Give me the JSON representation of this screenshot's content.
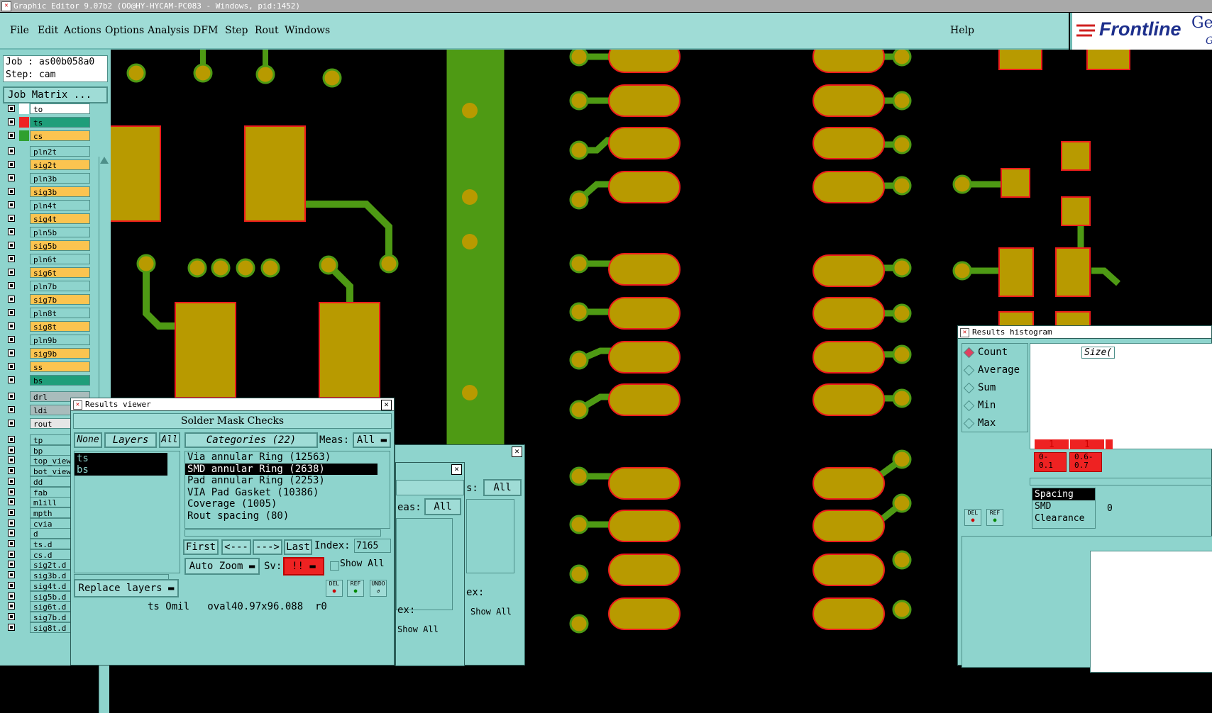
{
  "window": {
    "title": "Graphic Editor 9.07b2 (OO@HY-HYCAM-PC083 - Windows, pid:1452)"
  },
  "menu": {
    "file": "File",
    "edit": "Edit",
    "actions": "Actions",
    "options": "Options",
    "analysis": "Analysis",
    "dfm": "DFM",
    "step": "Step",
    "rout": "Rout",
    "windows": "Windows",
    "help": "Help"
  },
  "logo": {
    "brand": "Frontline",
    "brand_suffix": "Ge",
    "brand_sub": "G"
  },
  "job": {
    "job_label": "Job : as00b058a0",
    "step_label": "Step: cam",
    "matrix_button": "Job Matrix ..."
  },
  "layers": [
    {
      "name": "to",
      "color": "#ffffff",
      "bg": "#ffffff"
    },
    {
      "name": "ts",
      "color": "#ee2222",
      "bg": "#1f9e7a",
      "active": true
    },
    {
      "name": "cs",
      "color": "#2fa02f",
      "bg": "#fbc450"
    },
    {
      "name": "pln2t",
      "color": "",
      "bg": "#8ed4cd"
    },
    {
      "name": "sig2t",
      "color": "",
      "bg": "#fbc450"
    },
    {
      "name": "pln3b",
      "color": "",
      "bg": "#8ed4cd"
    },
    {
      "name": "sig3b",
      "color": "",
      "bg": "#fbc450"
    },
    {
      "name": "pln4t",
      "color": "",
      "bg": "#8ed4cd"
    },
    {
      "name": "sig4t",
      "color": "",
      "bg": "#fbc450"
    },
    {
      "name": "pln5b",
      "color": "",
      "bg": "#8ed4cd"
    },
    {
      "name": "sig5b",
      "color": "",
      "bg": "#fbc450"
    },
    {
      "name": "pln6t",
      "color": "",
      "bg": "#8ed4cd"
    },
    {
      "name": "sig6t",
      "color": "",
      "bg": "#fbc450"
    },
    {
      "name": "pln7b",
      "color": "",
      "bg": "#8ed4cd"
    },
    {
      "name": "sig7b",
      "color": "",
      "bg": "#fbc450"
    },
    {
      "name": "pln8t",
      "color": "",
      "bg": "#8ed4cd"
    },
    {
      "name": "sig8t",
      "color": "",
      "bg": "#fbc450"
    },
    {
      "name": "pln9b",
      "color": "",
      "bg": "#8ed4cd"
    },
    {
      "name": "sig9b",
      "color": "",
      "bg": "#fbc450"
    },
    {
      "name": "ss",
      "color": "",
      "bg": "#fbc450"
    },
    {
      "name": "bs",
      "color": "",
      "bg": "#1f9e7a"
    },
    {
      "name": "drl",
      "color": "",
      "bg": "#a9bcbc"
    },
    {
      "name": "ldi",
      "color": "",
      "bg": "#a9bcbc"
    },
    {
      "name": "rout",
      "color": "",
      "bg": "#e6e6e6"
    },
    {
      "name": "tp",
      "color": "",
      "bg": "#8ed4cd"
    },
    {
      "name": "bp",
      "color": "",
      "bg": "#8ed4cd"
    },
    {
      "name": "top_view",
      "color": "",
      "bg": "#8ed4cd"
    },
    {
      "name": "bot_view",
      "color": "",
      "bg": "#8ed4cd"
    },
    {
      "name": "dd",
      "color": "",
      "bg": "#8ed4cd"
    },
    {
      "name": "fab",
      "color": "",
      "bg": "#8ed4cd"
    },
    {
      "name": "m1ill",
      "color": "",
      "bg": "#8ed4cd"
    },
    {
      "name": "mpth",
      "color": "",
      "bg": "#8ed4cd"
    },
    {
      "name": "cvia",
      "color": "",
      "bg": "#8ed4cd"
    },
    {
      "name": "d",
      "color": "",
      "bg": "#8ed4cd"
    },
    {
      "name": "ts.d",
      "color": "",
      "bg": "#8ed4cd"
    },
    {
      "name": "cs.d",
      "color": "",
      "bg": "#8ed4cd"
    },
    {
      "name": "sig2t.d",
      "color": "",
      "bg": "#8ed4cd"
    },
    {
      "name": "sig3b.d",
      "color": "",
      "bg": "#8ed4cd"
    },
    {
      "name": "sig4t.d",
      "color": "",
      "bg": "#8ed4cd"
    },
    {
      "name": "sig5b.d",
      "color": "",
      "bg": "#8ed4cd"
    },
    {
      "name": "sig6t.d",
      "color": "",
      "bg": "#8ed4cd"
    },
    {
      "name": "sig7b.d",
      "color": "",
      "bg": "#8ed4cd"
    },
    {
      "name": "sig8t.d",
      "color": "",
      "bg": "#8ed4cd"
    }
  ],
  "results_viewer": {
    "title": "Results viewer",
    "header": "Solder Mask Checks",
    "none_btn": "None",
    "layers_btn": "Layers",
    "all_btn": "All",
    "categories_btn": "Categories (22)",
    "meas_label": "Meas:",
    "meas_value": "All",
    "layers_list": [
      "ts",
      "bs"
    ],
    "categories": [
      "Via annular Ring (12563)",
      "SMD annular Ring (2638)",
      "Pad annular Ring (2253)",
      "VIA Pad Gasket (10386)",
      "Coverage (1005)",
      "Rout spacing (80)"
    ],
    "selected_category": "SMD annular Ring (2638)",
    "first": "First",
    "prev": "<---",
    "next": "--->",
    "last": "Last",
    "index_label": "Index:",
    "index_value": "7165",
    "auto_zoom": "Auto Zoom",
    "sv_label": "Sv:",
    "sv_value": "!!",
    "show_all": "Show All",
    "replace_layers": "Replace layers",
    "del": "DEL",
    "ref": "REF",
    "undo": "UNDO",
    "status": "ts Omil   oval40.97x96.088  r0"
  },
  "back_dialog": {
    "meas_label": "s:",
    "meas_value": "All",
    "meas_label2": "eas:",
    "meas_value2": "All",
    "index_label": "ex:",
    "show_all": "Show All"
  },
  "histogram": {
    "title": "Results histogram",
    "options": [
      "Count",
      "Average",
      "Sum",
      "Min",
      "Max"
    ],
    "selected": "Count",
    "size_label": "Size(",
    "bins": [
      {
        "count": "1",
        "label": "0-\n0.1"
      },
      {
        "count": "1",
        "label": "0.6-\n0.7"
      }
    ],
    "list": [
      "Spacing",
      "SMD",
      "Clearance"
    ],
    "list_extra": "0",
    "del": "DEL",
    "ref": "REF"
  }
}
